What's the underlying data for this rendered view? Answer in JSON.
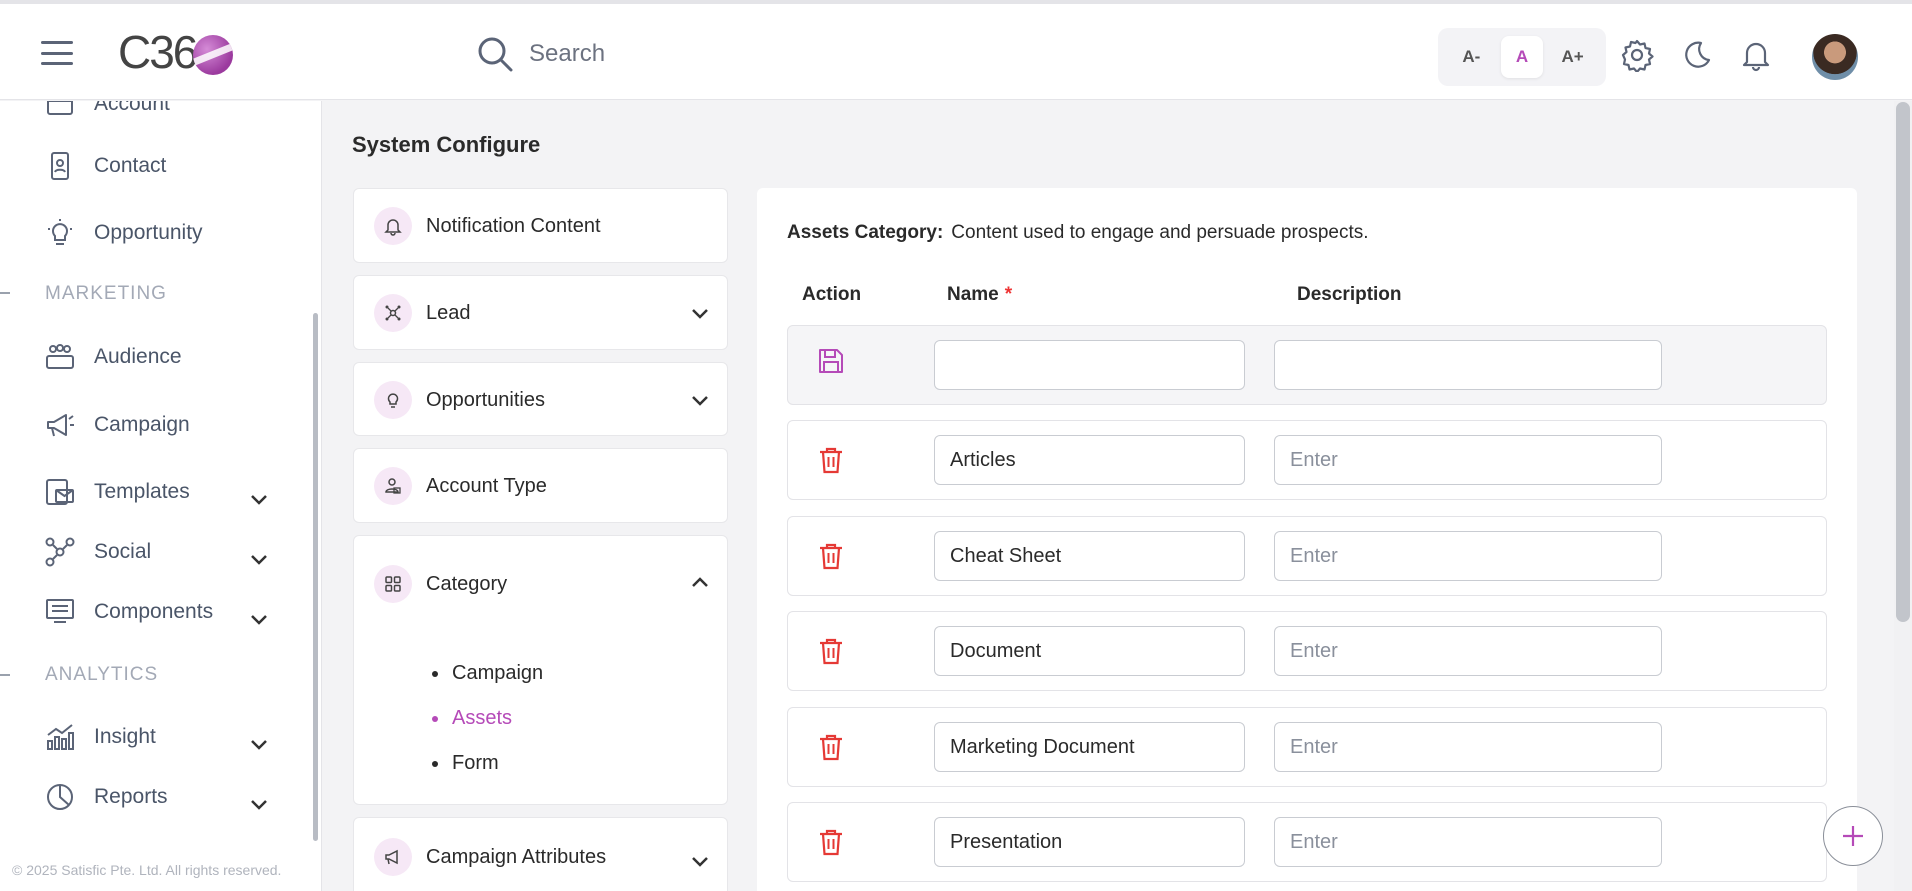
{
  "header": {
    "logo_text": "C36",
    "search_placeholder": "Search",
    "font_size_buttons": [
      "A-",
      "A",
      "A+"
    ],
    "active_font_size": "A"
  },
  "sidebar": {
    "items_top": [
      {
        "label": "Account",
        "icon": "account-icon"
      },
      {
        "label": "Contact",
        "icon": "contact-icon"
      },
      {
        "label": "Opportunity",
        "icon": "lightbulb-icon"
      }
    ],
    "marketing_label": "MARKETING",
    "marketing_items": [
      {
        "label": "Audience",
        "icon": "audience-icon"
      },
      {
        "label": "Campaign",
        "icon": "megaphone-icon"
      },
      {
        "label": "Templates",
        "icon": "template-icon"
      },
      {
        "label": "Social",
        "icon": "social-icon"
      },
      {
        "label": "Components",
        "icon": "components-icon"
      }
    ],
    "analytics_label": "ANALYTICS",
    "analytics_items": [
      {
        "label": "Insight",
        "icon": "insight-icon"
      },
      {
        "label": "Reports",
        "icon": "reports-icon"
      }
    ],
    "footer": "© 2025 Satisfic Pte. Ltd. All rights reserved."
  },
  "main": {
    "title": "System Configure",
    "config_items": [
      {
        "label": "Notification Content",
        "icon": "bell-icon"
      },
      {
        "label": "Lead",
        "icon": "lead-icon"
      },
      {
        "label": "Opportunities",
        "icon": "lightbulb-icon"
      },
      {
        "label": "Account Type",
        "icon": "account-type-icon"
      },
      {
        "label": "Category",
        "icon": "grid-icon"
      },
      {
        "label": "Campaign Attributes",
        "icon": "megaphone-icon"
      }
    ],
    "category_sub": [
      "Campaign",
      "Assets",
      "Form"
    ],
    "category_active": "Assets",
    "panel": {
      "heading": "Assets Category:",
      "description": "Content used to engage and persuade prospects.",
      "col_action": "Action",
      "col_name": "Name",
      "col_required": "*",
      "col_description": "Description",
      "desc_placeholder": "Enter",
      "rows": [
        "Articles",
        "Cheat Sheet",
        "Document",
        "Marketing Document",
        "Presentation"
      ]
    }
  },
  "colors": {
    "accent": "#b54ab8",
    "delete": "#e53935"
  }
}
